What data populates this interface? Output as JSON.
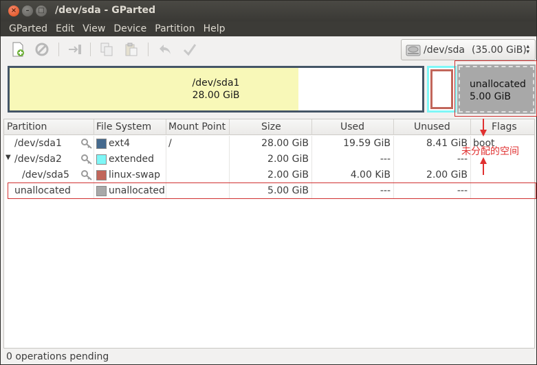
{
  "window": {
    "title": "/dev/sda - GParted"
  },
  "menubar": {
    "items": [
      "GParted",
      "Edit",
      "View",
      "Device",
      "Partition",
      "Help"
    ]
  },
  "toolbar": {
    "buttons": [
      "new-icon",
      "delete-icon",
      "resize-move-icon",
      "copy-icon",
      "paste-icon",
      "undo-icon",
      "apply-icon"
    ]
  },
  "device": {
    "name": "/dev/sda",
    "size": "(35.00 GiB)"
  },
  "diskmap": {
    "sda1": {
      "name": "/dev/sda1",
      "size": "28.00 GiB",
      "used_fraction": 0.7
    },
    "unallocated": {
      "name": "unallocated",
      "size": "5.00 GiB"
    }
  },
  "table": {
    "headers": [
      "Partition",
      "File System",
      "Mount Point",
      "Size",
      "Used",
      "Unused",
      "Flags"
    ],
    "rows": [
      {
        "partition": "/dev/sda1",
        "filesystem": "ext4",
        "fs_color": "#456a8e",
        "mount": "/",
        "size": "28.00 GiB",
        "used": "19.59 GiB",
        "unused": "8.41 GiB",
        "flags": "boot"
      },
      {
        "partition": "/dev/sda2",
        "filesystem": "extended",
        "fs_color": "#7ef7f7",
        "mount": "",
        "size": "2.00 GiB",
        "used": "---",
        "unused": "---",
        "flags": ""
      },
      {
        "partition": "/dev/sda5",
        "filesystem": "linux-swap",
        "fs_color": "#c1665a",
        "mount": "",
        "size": "2.00 GiB",
        "used": "4.00 KiB",
        "unused": "2.00 GiB",
        "flags": ""
      },
      {
        "partition": "unallocated",
        "filesystem": "unallocated",
        "fs_color": "#a8a8a8",
        "mount": "",
        "size": "5.00 GiB",
        "used": "---",
        "unused": "---",
        "flags": ""
      }
    ]
  },
  "annotation": {
    "text": "未分配的空间",
    "color": "#e03030"
  },
  "status": {
    "text": "0 operations pending"
  }
}
